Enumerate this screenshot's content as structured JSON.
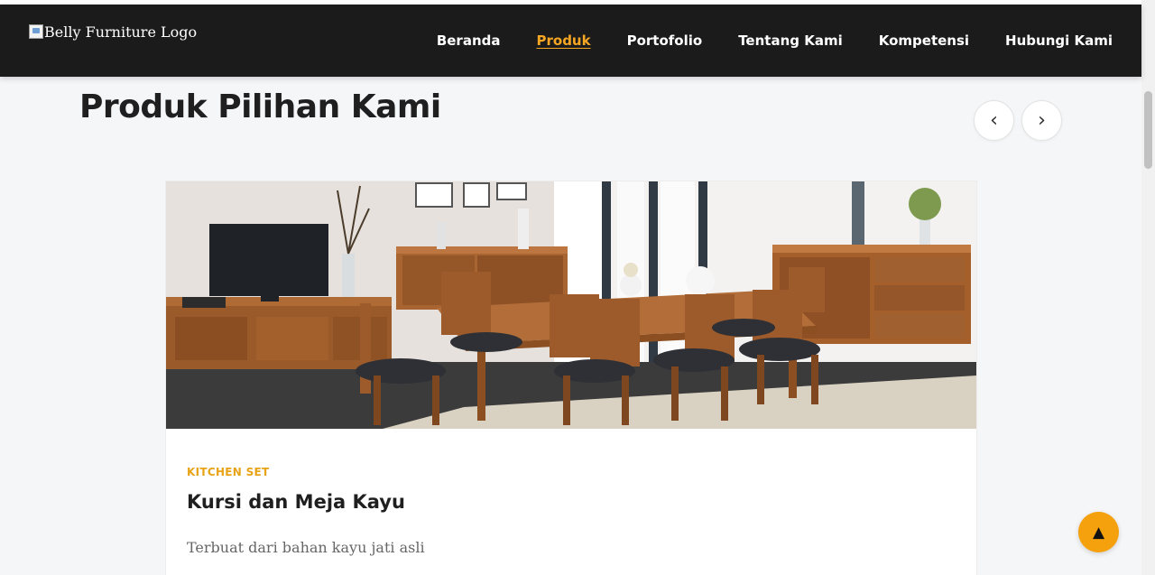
{
  "header": {
    "logo_alt": "Belly Furniture Logo",
    "nav": [
      {
        "label": "Beranda",
        "active": false
      },
      {
        "label": "Produk",
        "active": true
      },
      {
        "label": "Portofolio",
        "active": false
      },
      {
        "label": "Tentang Kami",
        "active": false
      },
      {
        "label": "Kompetensi",
        "active": false
      },
      {
        "label": "Hubungi Kami",
        "active": false
      }
    ]
  },
  "section": {
    "title": "Produk Pilihan Kami",
    "prev_icon": "‹",
    "next_icon": "›"
  },
  "product": {
    "category": "KITCHEN SET",
    "title": "Kursi dan Meja Kayu",
    "description": "Terbuat dari bahan kayu jati asli"
  },
  "scroll_top_icon": "▲",
  "colors": {
    "accent": "#f5a623",
    "navbar": "#1b1b1b",
    "scroll_top": "#f5a00d"
  }
}
